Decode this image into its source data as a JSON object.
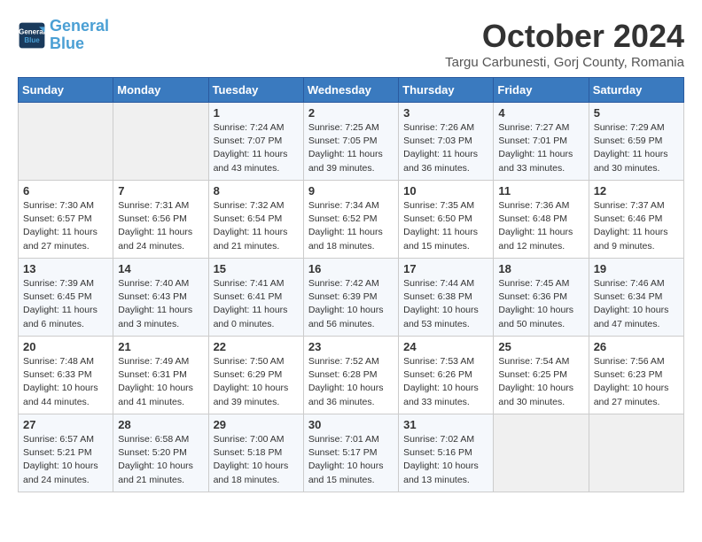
{
  "logo": {
    "line1": "General",
    "line2": "Blue"
  },
  "title": "October 2024",
  "subtitle": "Targu Carbunesti, Gorj County, Romania",
  "days_of_week": [
    "Sunday",
    "Monday",
    "Tuesday",
    "Wednesday",
    "Thursday",
    "Friday",
    "Saturday"
  ],
  "weeks": [
    [
      {
        "day": "",
        "info": ""
      },
      {
        "day": "",
        "info": ""
      },
      {
        "day": "1",
        "info": "Sunrise: 7:24 AM\nSunset: 7:07 PM\nDaylight: 11 hours and 43 minutes."
      },
      {
        "day": "2",
        "info": "Sunrise: 7:25 AM\nSunset: 7:05 PM\nDaylight: 11 hours and 39 minutes."
      },
      {
        "day": "3",
        "info": "Sunrise: 7:26 AM\nSunset: 7:03 PM\nDaylight: 11 hours and 36 minutes."
      },
      {
        "day": "4",
        "info": "Sunrise: 7:27 AM\nSunset: 7:01 PM\nDaylight: 11 hours and 33 minutes."
      },
      {
        "day": "5",
        "info": "Sunrise: 7:29 AM\nSunset: 6:59 PM\nDaylight: 11 hours and 30 minutes."
      }
    ],
    [
      {
        "day": "6",
        "info": "Sunrise: 7:30 AM\nSunset: 6:57 PM\nDaylight: 11 hours and 27 minutes."
      },
      {
        "day": "7",
        "info": "Sunrise: 7:31 AM\nSunset: 6:56 PM\nDaylight: 11 hours and 24 minutes."
      },
      {
        "day": "8",
        "info": "Sunrise: 7:32 AM\nSunset: 6:54 PM\nDaylight: 11 hours and 21 minutes."
      },
      {
        "day": "9",
        "info": "Sunrise: 7:34 AM\nSunset: 6:52 PM\nDaylight: 11 hours and 18 minutes."
      },
      {
        "day": "10",
        "info": "Sunrise: 7:35 AM\nSunset: 6:50 PM\nDaylight: 11 hours and 15 minutes."
      },
      {
        "day": "11",
        "info": "Sunrise: 7:36 AM\nSunset: 6:48 PM\nDaylight: 11 hours and 12 minutes."
      },
      {
        "day": "12",
        "info": "Sunrise: 7:37 AM\nSunset: 6:46 PM\nDaylight: 11 hours and 9 minutes."
      }
    ],
    [
      {
        "day": "13",
        "info": "Sunrise: 7:39 AM\nSunset: 6:45 PM\nDaylight: 11 hours and 6 minutes."
      },
      {
        "day": "14",
        "info": "Sunrise: 7:40 AM\nSunset: 6:43 PM\nDaylight: 11 hours and 3 minutes."
      },
      {
        "day": "15",
        "info": "Sunrise: 7:41 AM\nSunset: 6:41 PM\nDaylight: 11 hours and 0 minutes."
      },
      {
        "day": "16",
        "info": "Sunrise: 7:42 AM\nSunset: 6:39 PM\nDaylight: 10 hours and 56 minutes."
      },
      {
        "day": "17",
        "info": "Sunrise: 7:44 AM\nSunset: 6:38 PM\nDaylight: 10 hours and 53 minutes."
      },
      {
        "day": "18",
        "info": "Sunrise: 7:45 AM\nSunset: 6:36 PM\nDaylight: 10 hours and 50 minutes."
      },
      {
        "day": "19",
        "info": "Sunrise: 7:46 AM\nSunset: 6:34 PM\nDaylight: 10 hours and 47 minutes."
      }
    ],
    [
      {
        "day": "20",
        "info": "Sunrise: 7:48 AM\nSunset: 6:33 PM\nDaylight: 10 hours and 44 minutes."
      },
      {
        "day": "21",
        "info": "Sunrise: 7:49 AM\nSunset: 6:31 PM\nDaylight: 10 hours and 41 minutes."
      },
      {
        "day": "22",
        "info": "Sunrise: 7:50 AM\nSunset: 6:29 PM\nDaylight: 10 hours and 39 minutes."
      },
      {
        "day": "23",
        "info": "Sunrise: 7:52 AM\nSunset: 6:28 PM\nDaylight: 10 hours and 36 minutes."
      },
      {
        "day": "24",
        "info": "Sunrise: 7:53 AM\nSunset: 6:26 PM\nDaylight: 10 hours and 33 minutes."
      },
      {
        "day": "25",
        "info": "Sunrise: 7:54 AM\nSunset: 6:25 PM\nDaylight: 10 hours and 30 minutes."
      },
      {
        "day": "26",
        "info": "Sunrise: 7:56 AM\nSunset: 6:23 PM\nDaylight: 10 hours and 27 minutes."
      }
    ],
    [
      {
        "day": "27",
        "info": "Sunrise: 6:57 AM\nSunset: 5:21 PM\nDaylight: 10 hours and 24 minutes."
      },
      {
        "day": "28",
        "info": "Sunrise: 6:58 AM\nSunset: 5:20 PM\nDaylight: 10 hours and 21 minutes."
      },
      {
        "day": "29",
        "info": "Sunrise: 7:00 AM\nSunset: 5:18 PM\nDaylight: 10 hours and 18 minutes."
      },
      {
        "day": "30",
        "info": "Sunrise: 7:01 AM\nSunset: 5:17 PM\nDaylight: 10 hours and 15 minutes."
      },
      {
        "day": "31",
        "info": "Sunrise: 7:02 AM\nSunset: 5:16 PM\nDaylight: 10 hours and 13 minutes."
      },
      {
        "day": "",
        "info": ""
      },
      {
        "day": "",
        "info": ""
      }
    ]
  ]
}
